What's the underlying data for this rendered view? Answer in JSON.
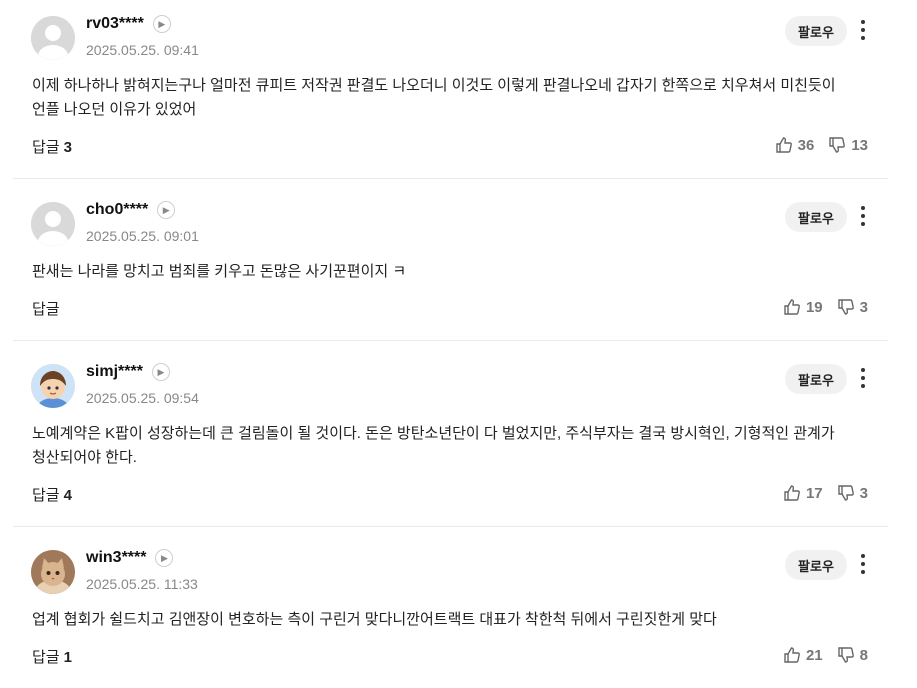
{
  "labels": {
    "follow": "팔로우",
    "reply": "답글"
  },
  "comments": [
    {
      "user": "rv03****",
      "date": "2025.05.25. 09:41",
      "text": "이제 하나하나 밝혀지는구나 얼마전 큐피트 저작권 판결도 나오더니 이것도 이렇게 판결나오네 갑자기 한쪽으로 치우쳐서 미친듯이 언플 나오던 이유가 있었어",
      "replies": "3",
      "likes": "36",
      "dislikes": "13",
      "avatar": "default-avatar"
    },
    {
      "user": "cho0****",
      "date": "2025.05.25. 09:01",
      "text": "판새는 나라를 망치고 범죄를 키우고 돈많은 사기꾼편이지 ㅋ",
      "replies": "",
      "likes": "19",
      "dislikes": "3",
      "avatar": "default-avatar"
    },
    {
      "user": "simj****",
      "date": "2025.05.25. 09:54",
      "text": "노예계약은 K팝이 성장하는데 큰 걸림돌이 될 것이다. 돈은 방탄소년단이 다 벌었지만, 주식부자는 결국 방시혁인, 기형적인 관계가 청산되어야 한다.",
      "replies": "4",
      "likes": "17",
      "dislikes": "3",
      "avatar": "cartoon-boy-avatar"
    },
    {
      "user": "win3****",
      "date": "2025.05.25. 11:33",
      "text": "업계 협회가 쉴드치고 김앤장이 변호하는 측이 구린거 맞다니깐어트랙트 대표가 착한척 뒤에서 구린짓한게 맞다",
      "replies": "1",
      "likes": "21",
      "dislikes": "8",
      "avatar": "cat-photo-avatar"
    }
  ],
  "colors": {
    "follow_bg": "#f1f1f1",
    "meta_text": "#888888",
    "divider": "#ebebeb"
  }
}
